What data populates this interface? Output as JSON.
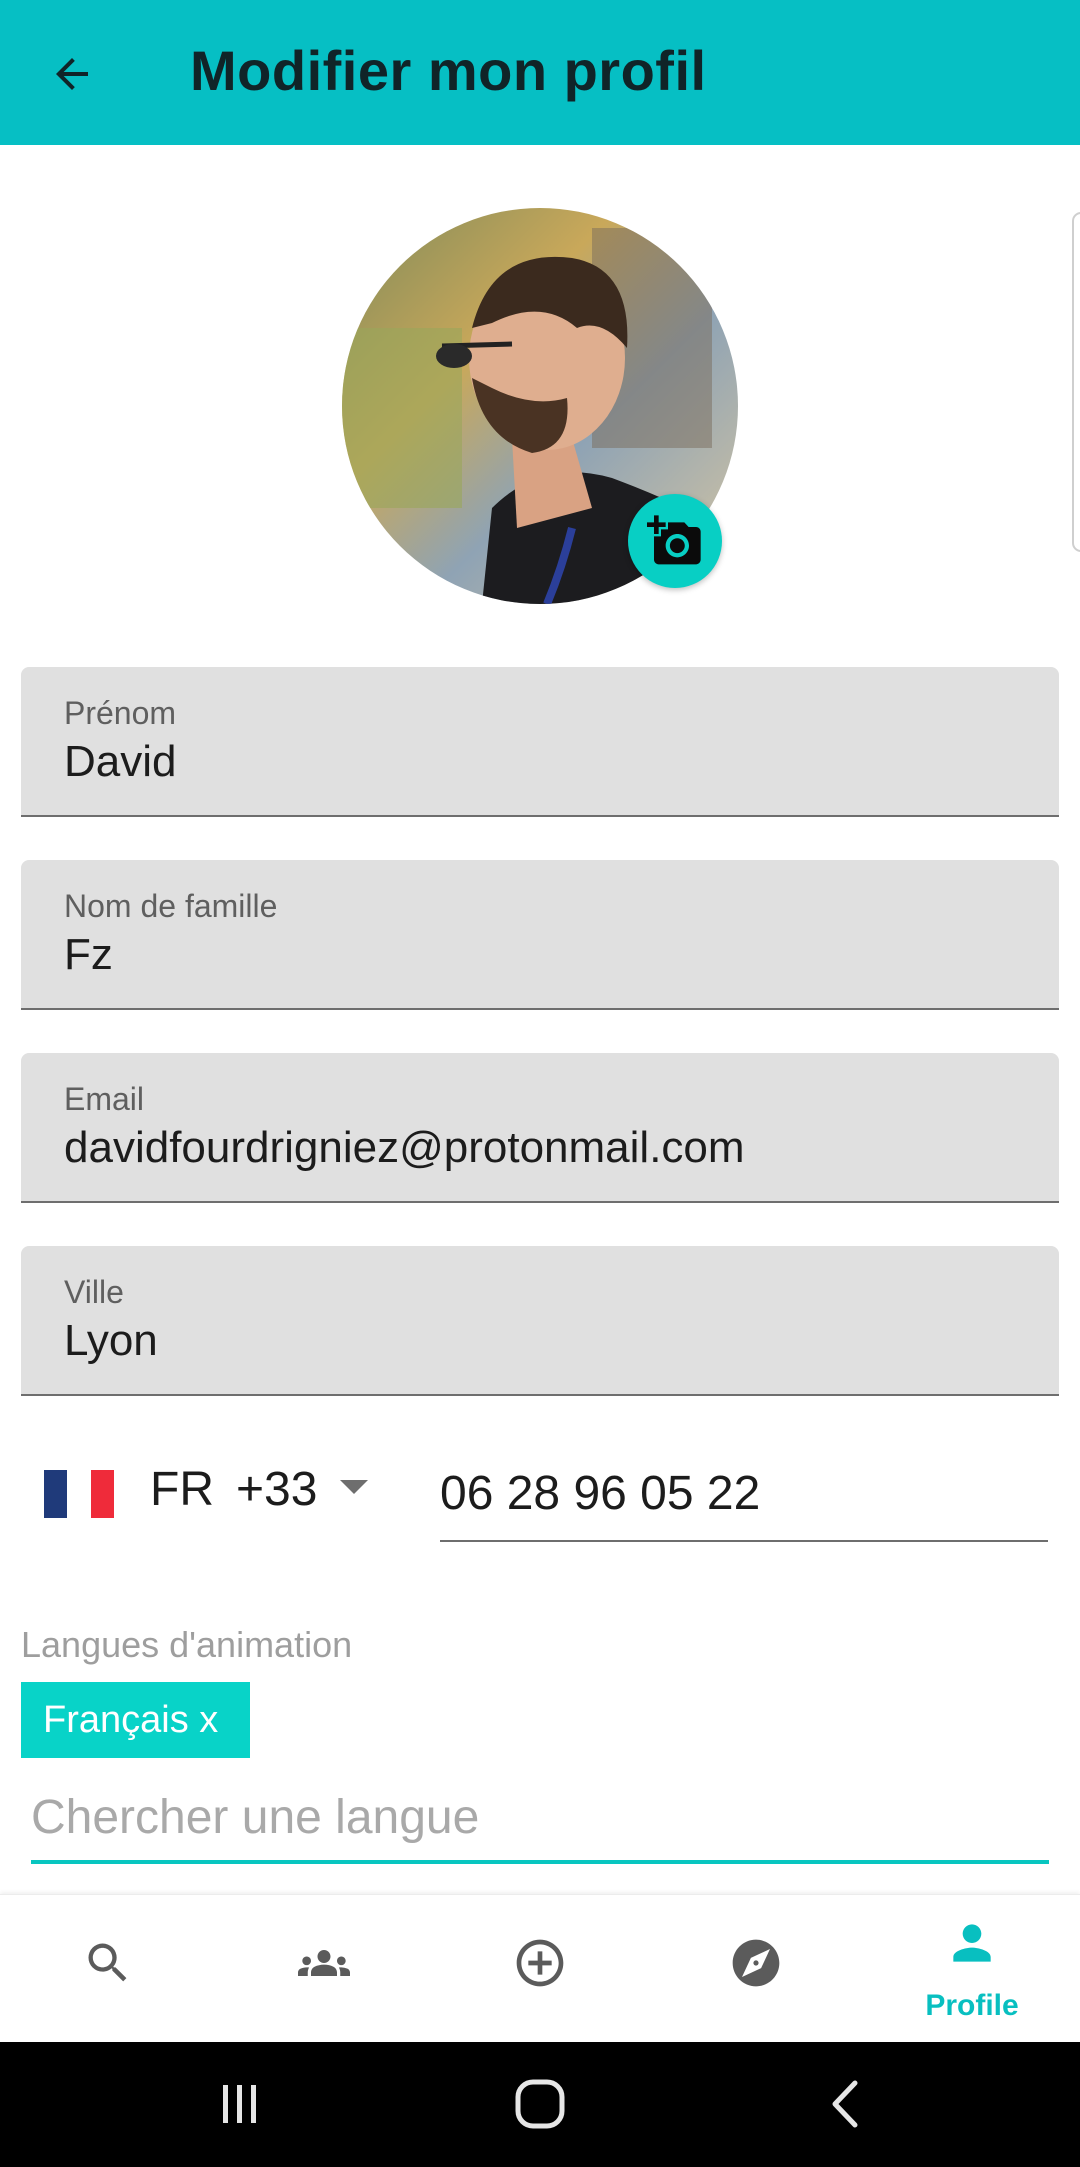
{
  "appbar": {
    "title": "Modifier mon profil",
    "color": "#06bfc4"
  },
  "fields": {
    "first_name": {
      "label": "Prénom",
      "value": "David"
    },
    "last_name": {
      "label": "Nom de famille",
      "value": "Fz"
    },
    "email": {
      "label": "Email",
      "value": "davidfourdrigniez@protonmail.com"
    },
    "city": {
      "label": "Ville",
      "value": "Lyon"
    }
  },
  "phone": {
    "country_code": "FR",
    "dial_code": "+33",
    "number": "06 28 96 05 22"
  },
  "languages": {
    "label": "Langues d'animation",
    "chips": [
      "Français x"
    ],
    "search_placeholder": "Chercher une langue"
  },
  "bottom_nav": {
    "items": [
      {
        "icon": "search-icon",
        "label": ""
      },
      {
        "icon": "groups-icon",
        "label": ""
      },
      {
        "icon": "add-circle-icon",
        "label": ""
      },
      {
        "icon": "explore-icon",
        "label": ""
      },
      {
        "icon": "person-icon",
        "label": "Profile",
        "active": true
      }
    ],
    "active_color": "#08bfc0"
  },
  "system_nav": {
    "icons": [
      "recents-icon",
      "home-icon",
      "back-icon"
    ]
  }
}
